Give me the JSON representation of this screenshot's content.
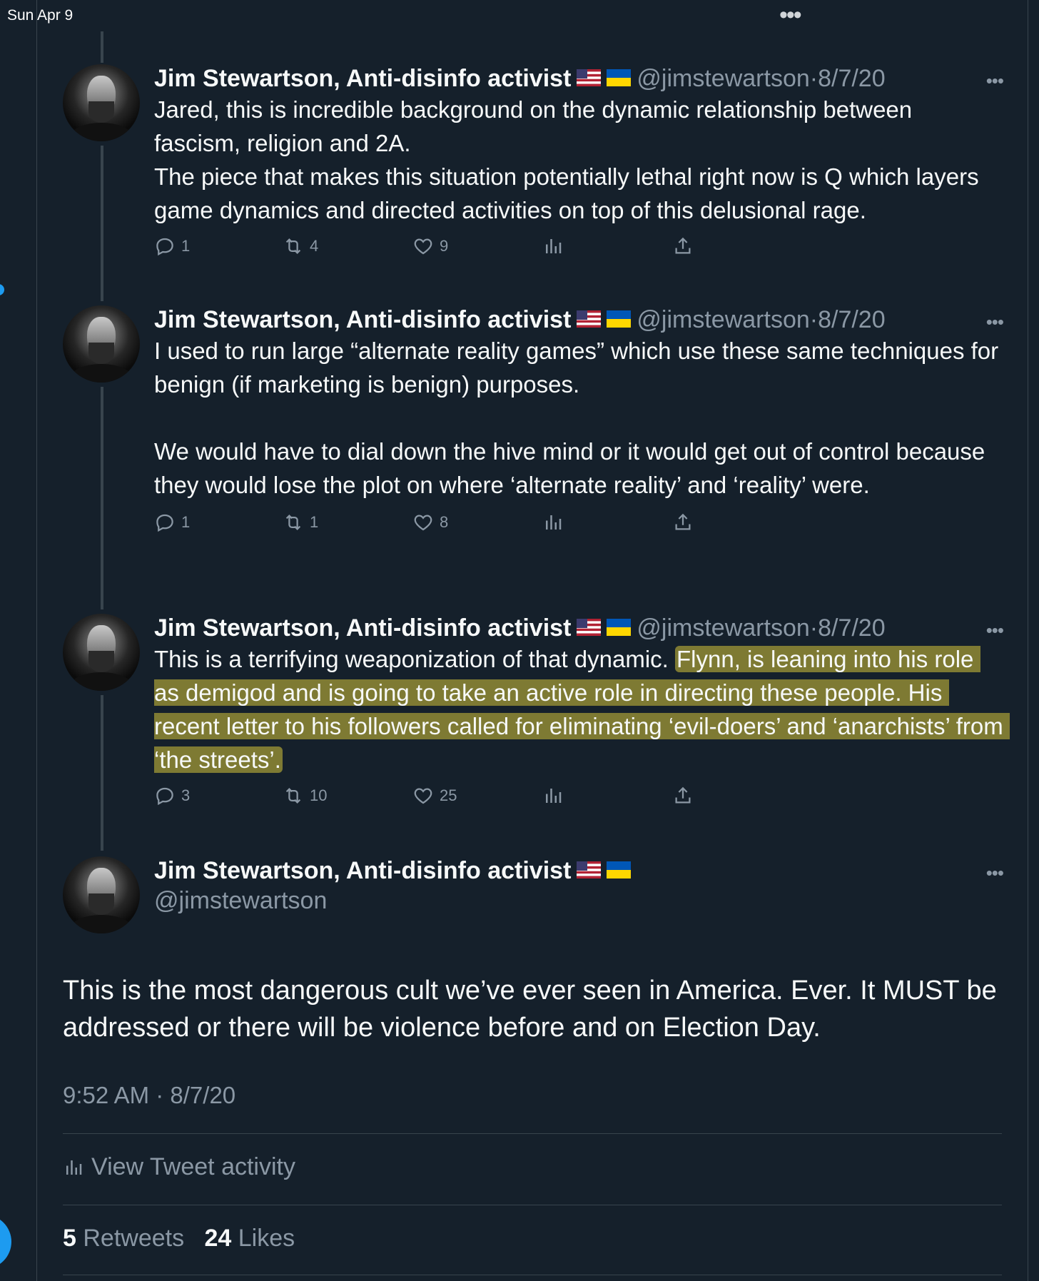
{
  "status_bar": {
    "time": "Sun Apr 9",
    "dots": "•••"
  },
  "colors": {
    "background": "#15202b",
    "text": "#f7f9f9",
    "muted": "#8b98a5",
    "accent": "#1d9bf0",
    "highlight": "#d6c53a"
  },
  "thread": [
    {
      "name": "Jim Stewartson, Anti-disinfo activist",
      "handle": "@jimstewartson",
      "separator": "·",
      "date": "8/7/20",
      "text": "Jared, this is incredible background on the dynamic relationship between fascism, religion and 2A.\nThe piece that makes this situation potentially lethal right now is Q which layers game dynamics and directed activities on top of this delusional rage.",
      "replies": "1",
      "retweets": "4",
      "likes": "9"
    },
    {
      "name": "Jim Stewartson, Anti-disinfo activist",
      "handle": "@jimstewartson",
      "separator": "·",
      "date": "8/7/20",
      "text": "I used to run large “alternate reality games” which use these same techniques for benign (if marketing is benign) purposes.\n\nWe would have to dial down the hive mind or it would get out of control because they would lose the plot on where ‘alternate reality’ and ‘reality’ were.",
      "replies": "1",
      "retweets": "1",
      "likes": "8"
    },
    {
      "name": "Jim Stewartson, Anti-disinfo activist",
      "handle": "@jimstewartson",
      "separator": "·",
      "date": "8/7/20",
      "text_plain": "This is a terrifying weaponization of that dynamic. ",
      "text_highlighted": "Flynn, is leaning into his role as demigod and is going to take an active role in directing these people. His recent letter to his followers called for eliminating ‘evil-doers’ and ‘anarchists’ from ‘the streets’.",
      "replies": "3",
      "retweets": "10",
      "likes": "25"
    }
  ],
  "main_tweet": {
    "name": "Jim Stewartson, Anti-disinfo activist",
    "handle": "@jimstewartson",
    "text": "This is the most dangerous cult we’ve ever seen in America. Ever. It MUST be addressed or there will be violence before and on Election Day.",
    "timestamp": "9:52 AM · 8/7/20",
    "view_activity": "View Tweet activity",
    "retweet_count": "5",
    "retweet_label": "Retweets",
    "like_count": "24",
    "like_label": "Likes"
  },
  "icons": {
    "reply": "reply-icon",
    "retweet": "retweet-icon",
    "like": "heart-icon",
    "views": "analytics-icon",
    "share": "share-icon",
    "more": "more-icon",
    "flags": [
      "us-flag-icon",
      "ukraine-flag-icon"
    ]
  }
}
